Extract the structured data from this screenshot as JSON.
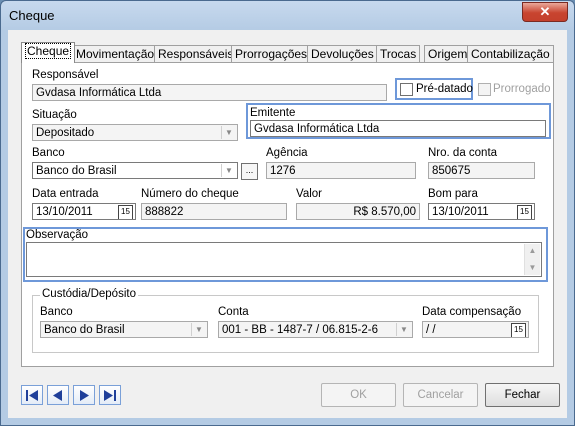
{
  "window": {
    "title": "Cheque",
    "close_glyph": "✕"
  },
  "tabs": [
    {
      "label": "Cheque"
    },
    {
      "label": "Movimentação"
    },
    {
      "label": "Responsáveis"
    },
    {
      "label": "Prorrogações"
    },
    {
      "label": "Devoluções"
    },
    {
      "label": "Trocas"
    },
    {
      "label": "Origem"
    },
    {
      "label": "Contabilização"
    }
  ],
  "responsavel": {
    "label": "Responsável",
    "value": "Gvdasa Informática Ltda"
  },
  "pre_datado": {
    "label": "Pré-datado",
    "checked": false
  },
  "prorrogado": {
    "label": "Prorrogado",
    "checked": false
  },
  "situacao": {
    "label": "Situação",
    "value": "Depositado"
  },
  "emitente": {
    "label": "Emitente",
    "value": "Gvdasa Informática Ltda"
  },
  "banco": {
    "label": "Banco",
    "value": "Banco do Brasil",
    "ellipsis": "..."
  },
  "agencia": {
    "label": "Agência",
    "value": "1276"
  },
  "nro_conta": {
    "label": "Nro. da conta",
    "value": "850675"
  },
  "data_entrada": {
    "label": "Data entrada",
    "value": "13/10/2011",
    "cal": "15"
  },
  "numero_cheque": {
    "label": "Número do cheque",
    "value": "888822"
  },
  "valor": {
    "label": "Valor",
    "value": "R$ 8.570,00"
  },
  "bom_para": {
    "label": "Bom para",
    "value": "13/10/2011",
    "cal": "15"
  },
  "observacao": {
    "label": "Observação",
    "value": ""
  },
  "custodia": {
    "title": "Custódia/Depósito",
    "banco": {
      "label": "Banco",
      "value": "Banco do Brasil"
    },
    "conta": {
      "label": "Conta",
      "value": "001 - BB - 1487-7 / 06.815-2-6"
    },
    "data_compensacao": {
      "label": "Data compensação",
      "value": " /  /",
      "cal": "15"
    }
  },
  "buttons": {
    "ok": "OK",
    "cancelar": "Cancelar",
    "fechar": "Fechar"
  },
  "nav_icons": [
    "first-record-icon",
    "previous-record-icon",
    "next-record-icon",
    "last-record-icon"
  ]
}
